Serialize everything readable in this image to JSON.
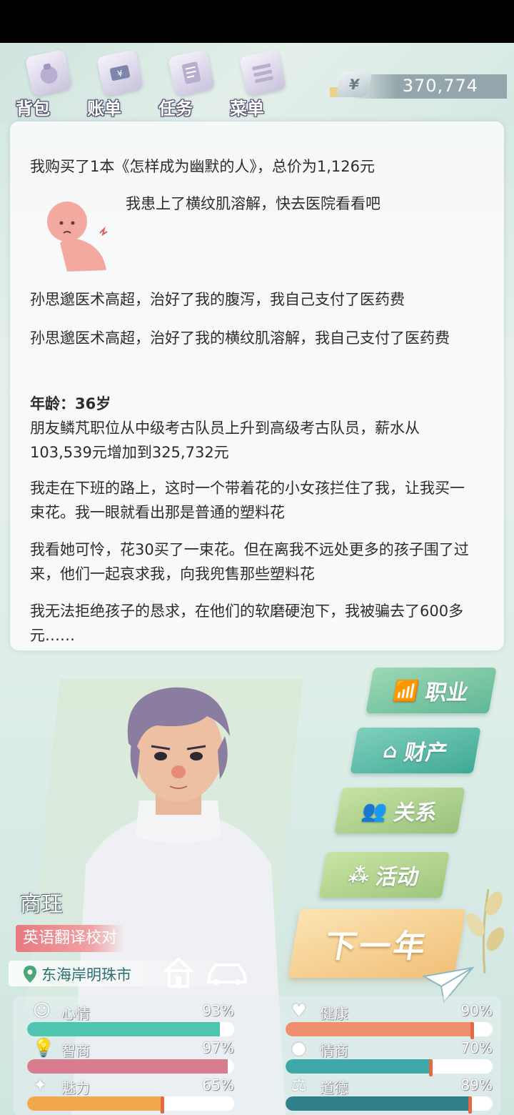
{
  "nav": {
    "items": [
      {
        "label": "背包",
        "icon": "bag-icon"
      },
      {
        "label": "账单",
        "icon": "bill-icon"
      },
      {
        "label": "任务",
        "icon": "task-icon"
      },
      {
        "label": "菜单",
        "icon": "menu-icon"
      }
    ]
  },
  "money": {
    "symbol": "¥",
    "value": "370,774"
  },
  "log": {
    "entries": [
      "我购买了1本《怎样成为幽默的人》，总价为1,126元",
      "我患上了横纹肌溶解，快去医院看看吧",
      "孙思邈医术高超，治好了我的腹泻，我自己支付了医药费",
      "孙思邈医术高超，治好了我的横纹肌溶解，我自己支付了医药费",
      "年龄：36岁",
      "朋友鳞芃职位从中级考古队员上升到高级考古队员，薪水从103,539元增加到325,732元",
      "我走在下班的路上，这时一个带着花的小女孩拦住了我，让我买一束花。我一眼就看出那是普通的塑料花",
      "我看她可怜，花30买了一束花。但在离我不远处更多的孩子围了过来，他们一起哀求我，向我兜售那些塑料花",
      "我无法拒绝孩子的恳求，在他们的软磨硬泡下，我被骗去了600多元……"
    ]
  },
  "actions": {
    "career": "职业",
    "property": "财产",
    "relations": "关系",
    "activity": "活动",
    "next_year": "下一年"
  },
  "character": {
    "name": "商珏",
    "job": "英语翻译校对",
    "location": "东海岸明珠市"
  },
  "stats": {
    "mood": {
      "label": "心情",
      "value": "93%",
      "pct": 93,
      "color": "#4fc4ae"
    },
    "health": {
      "label": "健康",
      "value": "90%",
      "pct": 90,
      "color": "#f08f6f"
    },
    "iq": {
      "label": "智商",
      "value": "97%",
      "pct": 97,
      "color": "#d87c8f"
    },
    "eq": {
      "label": "情商",
      "value": "70%",
      "pct": 70,
      "color": "#3ea7a8"
    },
    "charm": {
      "label": "魅力",
      "value": "65%",
      "pct": 65,
      "color": "#f2a94e"
    },
    "morality": {
      "label": "道德",
      "value": "89%",
      "pct": 89,
      "color": "#2e7f8a"
    }
  }
}
